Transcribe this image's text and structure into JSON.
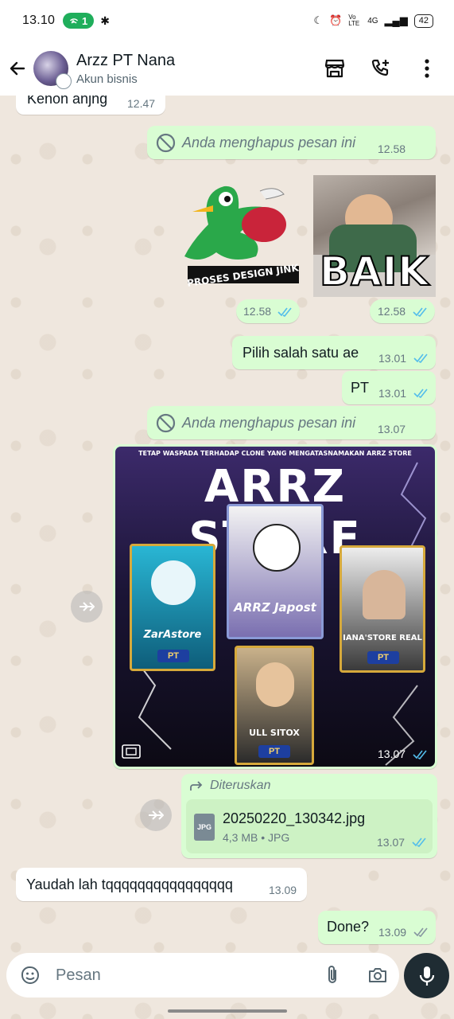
{
  "status_bar": {
    "time": "13.10",
    "hotspot_count": "1",
    "network": "4G",
    "volte": "Vo LTE",
    "battery": "42"
  },
  "header": {
    "name": "Arzz PT Nana",
    "subtitle": "Akun bisnis"
  },
  "messages": {
    "m0": {
      "text": "Kenon anjng",
      "time": "12.47"
    },
    "m1": {
      "text": "Anda menghapus pesan ini",
      "time": "12.58"
    },
    "m2": {
      "sticker_caption": "PROSES DESIGN JINK",
      "time": "12.58"
    },
    "m3": {
      "sticker_caption": "BAIK",
      "time": "12.58"
    },
    "m4": {
      "text": "Pilih salah satu ae",
      "time": "13.01"
    },
    "m5": {
      "text": "PT",
      "time": "13.01"
    },
    "m6": {
      "text": "Anda menghapus pesan ini",
      "time": "13.07"
    },
    "m7": {
      "time": "13.07",
      "banner": "TETAP WASPADA TERHADAP CLONE YANG MENGATASNAMAKAN ARRZ STORE",
      "title": "ARRZ STORE",
      "card_left": "ZarAstore",
      "card_center": "ARRZ Japost",
      "card_right": "IANA'STORE REAL",
      "card_bottom": "ULL SITOX",
      "badge": "PT"
    },
    "m8": {
      "forward_label": "Diteruskan",
      "filename": "20250220_130342.jpg",
      "filetype": "JPG",
      "fileinfo": "4,3 MB • JPG",
      "time": "13.07"
    },
    "m9": {
      "text": "Yaudah lah tqqqqqqqqqqqqqqqq",
      "time": "13.09"
    },
    "m10": {
      "text": "Done?",
      "time": "13.09"
    }
  },
  "input": {
    "placeholder": "Pesan"
  },
  "colors": {
    "outgoing_bubble": "#d9fdd3",
    "incoming_bubble": "#ffffff",
    "read_tick": "#53bdeb",
    "hotspot": "#1fae5b"
  }
}
